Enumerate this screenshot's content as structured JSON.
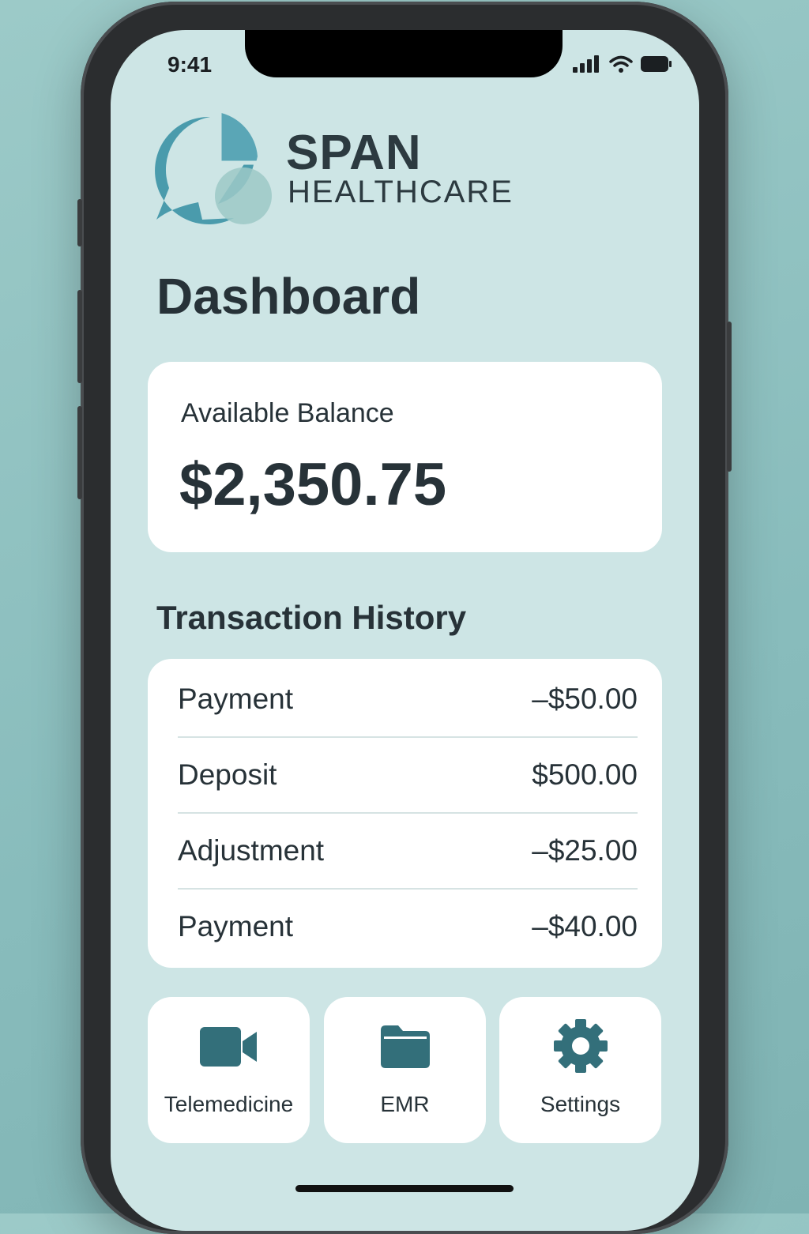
{
  "status_bar": {
    "time": "9:41",
    "icons": [
      "cellular-signal-icon",
      "wifi-icon",
      "battery-icon"
    ]
  },
  "brand": {
    "name": "SPAN",
    "subtitle": "HEALTHCARE",
    "logo_icon": "speech-bubble-pie-logo",
    "colors": {
      "primary": "#4a9bac",
      "secondary": "#8fc3c3"
    }
  },
  "page": {
    "title": "Dashboard"
  },
  "balance": {
    "label": "Available Balance",
    "value": "$2,350.75"
  },
  "transactions": {
    "title": "Transaction History",
    "rows": [
      {
        "type": "Payment",
        "amount": "–$50.00"
      },
      {
        "type": "Deposit",
        "amount": "$500.00"
      },
      {
        "type": "Adjustment",
        "amount": "–$25.00"
      },
      {
        "type": "Payment",
        "amount": "–$40.00"
      }
    ]
  },
  "quick_actions": [
    {
      "label": "Telemedicine",
      "icon": "video-camera-icon"
    },
    {
      "label": "EMR",
      "icon": "folder-icon"
    },
    {
      "label": "Settings",
      "icon": "gear-icon"
    }
  ],
  "colors": {
    "screen_background": "#cde5e5",
    "card_background": "#ffffff",
    "text": "#273238",
    "icon_accent": "#336f7a"
  }
}
